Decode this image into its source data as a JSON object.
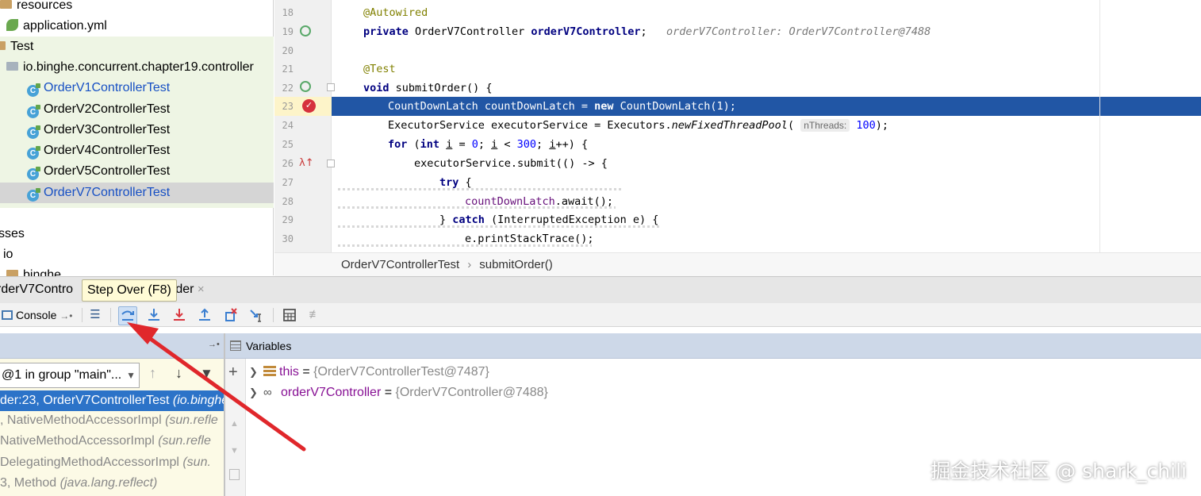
{
  "project_tree": {
    "items": [
      {
        "label": "resources",
        "icon": "folder-icon"
      },
      {
        "label": "application.yml",
        "icon": "yml-file-icon"
      },
      {
        "label": "Test",
        "icon": "folder-icon"
      },
      {
        "label": "io.binghe.concurrent.chapter19.controller",
        "icon": "package-icon"
      },
      {
        "label": "OrderV1ControllerTest",
        "icon": "test-class-icon"
      },
      {
        "label": "OrderV2ControllerTest",
        "icon": "test-class-icon"
      },
      {
        "label": "OrderV3ControllerTest",
        "icon": "test-class-icon"
      },
      {
        "label": "OrderV4ControllerTest",
        "icon": "test-class-icon"
      },
      {
        "label": "OrderV5ControllerTest",
        "icon": "test-class-icon"
      },
      {
        "label": "OrderV7ControllerTest",
        "icon": "test-class-icon"
      },
      {
        "label": "sses",
        "icon": ""
      },
      {
        "label": "io",
        "icon": ""
      },
      {
        "label": "binghe",
        "icon": "folder-icon"
      }
    ]
  },
  "editor": {
    "line_numbers": [
      "18",
      "19",
      "20",
      "21",
      "22",
      "23",
      "24",
      "25",
      "26",
      "27",
      "28",
      "29",
      "30"
    ],
    "l18": "@Autowired",
    "l19_kw": "private",
    "l19_type": " OrderV7Controller ",
    "l19_field": "orderV7Controller",
    "l19_end": ";",
    "l19_hint": "orderV7Controller: OrderV7Controller@7488",
    "l21": "@Test",
    "l22_kw": "void",
    "l22_rest": " submitOrder() {",
    "l23_a": "CountDownLatch countDownLatch = ",
    "l23_kw": "new",
    "l23_b": " CountDownLatch(1);",
    "l24_a": "ExecutorService executorService = Executors.",
    "l24_method": "newFixedThreadPool",
    "l24_paren": "(",
    "l24_hint": "nThreads:",
    "l24_num": "100",
    "l24_end": ");",
    "l25_kw1": "for",
    "l25_a": " (",
    "l25_kw2": "int",
    "l25_b": " ",
    "l25_var1": "i",
    "l25_c": " = ",
    "l25_num1": "0",
    "l25_d": "; ",
    "l25_var2": "i",
    "l25_e": " < ",
    "l25_num2": "300",
    "l25_f": "; ",
    "l25_var3": "i",
    "l25_g": "++) {",
    "l26": "executorService.submit(() -> {",
    "l27_kw": "try",
    "l27_rest": " {",
    "l28_field": "countDownLatch",
    "l28_rest": ".await();",
    "l29_a": "} ",
    "l29_kw": "catch",
    "l29_b": " (InterruptedException e) {",
    "l30": "e.printStackTrace();",
    "current_line": "23"
  },
  "breadcrumb": {
    "class_name": "OrderV7ControllerTest",
    "separator": "›",
    "method_name": "submitOrder()"
  },
  "debug": {
    "tab_left": "rderV7Contro",
    "tab_right": "rder",
    "tab_close": "×",
    "tooltip": "Step Over (F8)",
    "console_label": "Console",
    "toolbar_icons": [
      "show-execution-point-icon",
      "step-over-icon",
      "step-into-icon",
      "force-step-into-icon",
      "step-out-icon",
      "drop-frame-icon",
      "run-to-cursor-icon",
      "evaluate-expression-icon",
      "trace-icon"
    ],
    "thread_selector": "@1 in group \"main\"...",
    "frames": [
      {
        "text": "der:23, OrderV7ControllerTest ",
        "pkg": "(io.binghe"
      },
      {
        "text": ", NativeMethodAccessorImpl ",
        "pkg": "(sun.refle"
      },
      {
        "text": " NativeMethodAccessorImpl ",
        "pkg": "(sun.refle"
      },
      {
        "text": " DelegatingMethodAccessorImpl ",
        "pkg": "(sun."
      },
      {
        "text": "3, Method ",
        "pkg": "(java.lang.reflect)"
      }
    ],
    "variables_title": "Variables",
    "variables": [
      {
        "name": "this",
        "eq": " = ",
        "value": "{OrderV7ControllerTest@7487}",
        "icon": "field-icon"
      },
      {
        "name": "orderV7Controller",
        "eq": " = ",
        "value": "{OrderV7Controller@7488}",
        "icon": "watch-infinity-icon"
      }
    ]
  },
  "watermark": "掘金技术社区 @ shark_chili",
  "colors": {
    "selection": "#2156a5",
    "keyword": "#000080",
    "annotation": "#808000",
    "field": "#660e7a",
    "number": "#0000ff",
    "tree_green": "#eef5e4",
    "frame_active": "#2c73c8",
    "arrow": "#e0272b"
  }
}
